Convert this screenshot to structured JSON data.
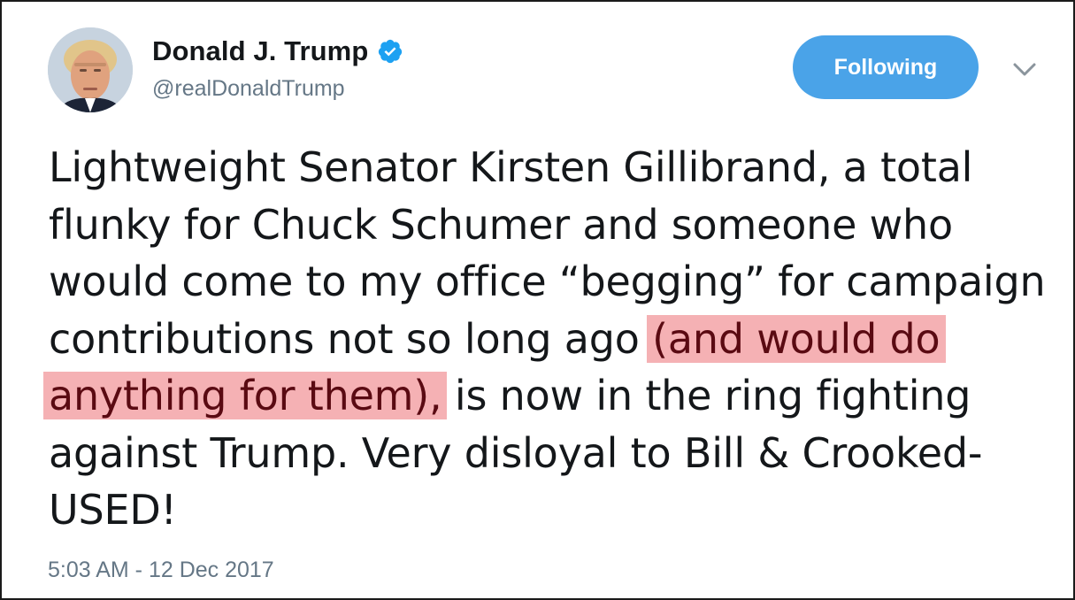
{
  "user": {
    "display_name": "Donald J. Trump",
    "handle": "@realDonaldTrump",
    "verified_icon": "verified-badge-icon"
  },
  "actions": {
    "follow_label": "Following",
    "more_icon": "chevron-down-icon"
  },
  "tweet": {
    "text_before": "Lightweight Senator Kirsten Gillibrand, a total flunky for Chuck Schumer and someone who would come to my office “begging” for campaign contributions not so long ago ",
    "text_highlighted": "(and would do anything for them),",
    "text_after": " is now in the ring fighting against Trump. Very disloyal to Bill & Crooked-USED!",
    "timestamp": "5:03 AM - 12 Dec 2017"
  },
  "colors": {
    "accent": "#4aa3e8",
    "highlight": "#f5b1b4",
    "muted_text": "#657786",
    "primary_text": "#14171a"
  }
}
